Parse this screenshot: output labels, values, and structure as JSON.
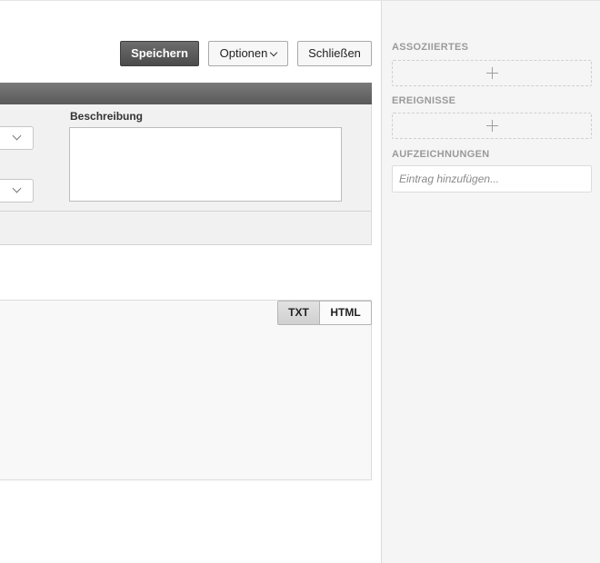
{
  "toolbar": {
    "save_label": "Speichern",
    "options_label": "Optionen",
    "close_label": "Schließen"
  },
  "form": {
    "description_label": "Beschreibung",
    "description_value": ""
  },
  "editor": {
    "modes": [
      "TXT",
      "HTML"
    ],
    "active_mode": "TXT"
  },
  "sidebar": {
    "associated_heading": "ASSOZIIERTES",
    "events_heading": "EREIGNISSE",
    "records_heading": "AUFZEICHNUNGEN",
    "records_placeholder": "Eintrag hinzufügen..."
  },
  "icons": {
    "add": "plus-icon",
    "dropdown": "chevron-down-icon"
  },
  "colors": {
    "primary_button": "#555555",
    "header_bar": "#6a6a6a",
    "panel_bg": "#f1f1f1",
    "sidebar_bg": "#f5f5f5",
    "muted_heading": "#9a9a9a"
  }
}
